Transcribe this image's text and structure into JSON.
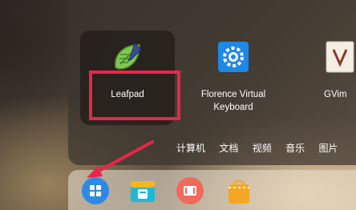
{
  "launcher": {
    "apps": [
      {
        "name": "Leafpad",
        "icon": "leafpad-notepad-icon"
      },
      {
        "name": "Florence Virtual\nKeyboard",
        "icon": "florence-keyboard-gear-icon"
      },
      {
        "name": "GVim",
        "icon": "gvim-document-icon"
      }
    ],
    "categories": [
      "计算机",
      "文档",
      "视频",
      "音乐",
      "图片"
    ]
  },
  "dock": {
    "items": [
      {
        "icon": "launcher-grid-icon"
      },
      {
        "icon": "file-manager-icon"
      },
      {
        "icon": "video-player-icon"
      },
      {
        "icon": "app-store-bag-icon"
      }
    ]
  },
  "annotations": {
    "highlight_color": "#e8264a"
  }
}
